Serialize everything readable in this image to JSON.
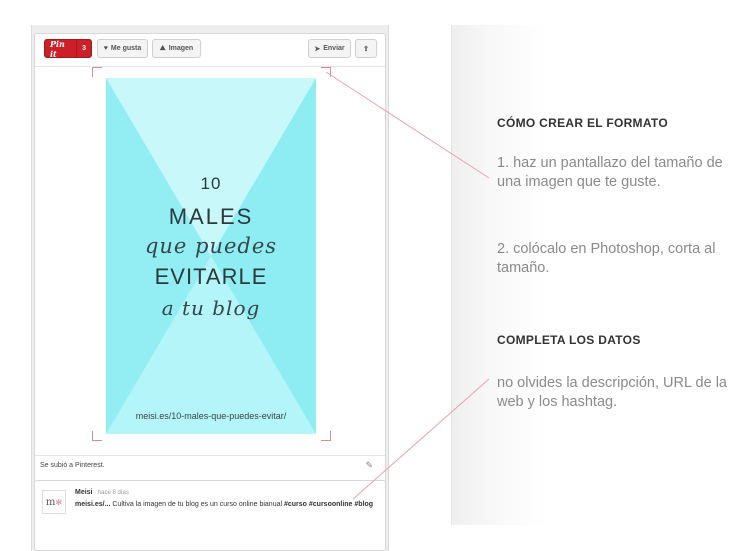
{
  "toolbar": {
    "pinit_label": "Pin it",
    "pinit_count": "3",
    "like_label": "Me gusta",
    "image_label": "Imagen",
    "send_label": "Enviar"
  },
  "pin_image": {
    "line1": "10",
    "line2": "MALES",
    "line3": "que puedes",
    "line4": "EVITARLE",
    "line5": "a tu blog",
    "url": "meisi.es/10-males-que-puedes-evitar/"
  },
  "uploaded_text": "Se subió a Pinterest.",
  "comment": {
    "avatar_text": "m",
    "author": "Meisi",
    "time": " · hace 8 días",
    "link_text": "meisi.es/...",
    "body": " Cultiva la imagen de tu blog es un curso online bianual ",
    "tags": "#curso #cursoonline #blog"
  },
  "instructions": {
    "heading1": "CÓMO CREAR EL FORMATO",
    "step1": "1. haz un pantallazo del tamaño de una imagen que te guste.",
    "step2": "2. colócalo en Photoshop, corta al tamaño.",
    "heading2": "COMPLETA LOS DATOS",
    "note": "no olvides la descripción, URL de la web y los hashtag."
  },
  "colors": {
    "pin_red": "#cb2027",
    "image_cyan": "#9ff2f6",
    "connector_pink": "#e8a2ad"
  }
}
